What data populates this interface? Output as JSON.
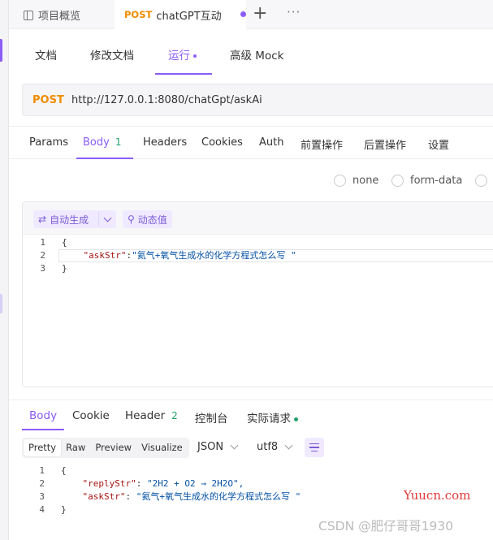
{
  "tabs": {
    "overview_label": "项目概览",
    "active_method": "POST",
    "active_title": "chatGPT互动"
  },
  "subnav": {
    "doc": "文档",
    "edit_doc": "修改文档",
    "run": "运行",
    "mock": "高级 Mock"
  },
  "request": {
    "method": "POST",
    "url": "http://127.0.0.1:8080/chatGpt/askAi"
  },
  "req_tabs": {
    "params": "Params",
    "body": "Body",
    "body_count": "1",
    "headers": "Headers",
    "cookies": "Cookies",
    "auth": "Auth",
    "pre": "前置操作",
    "post": "后置操作",
    "settings": "设置"
  },
  "body_types": {
    "none": "none",
    "form_data": "form-data"
  },
  "editor": {
    "auto_gen": "自动生成",
    "dynamic": "动态值",
    "lines": [
      {
        "n": "1",
        "pre": "{",
        "key": "",
        "mid": "",
        "val": ""
      },
      {
        "n": "2",
        "pre": "    ",
        "key": "\"askStr\"",
        "mid": ":",
        "val": "\"氦气+氧气生成水的化学方程式怎么写 \""
      },
      {
        "n": "3",
        "pre": "}",
        "key": "",
        "mid": "",
        "val": ""
      }
    ]
  },
  "res_tabs": {
    "body": "Body",
    "cookie": "Cookie",
    "header": "Header",
    "header_count": "2",
    "console": "控制台",
    "actual": "实际请求"
  },
  "format": {
    "pretty": "Pretty",
    "raw": "Raw",
    "preview": "Preview",
    "visualize": "Visualize",
    "lang": "JSON",
    "encoding": "utf8"
  },
  "response": {
    "lines": [
      {
        "n": "1",
        "pre": "{",
        "key": "",
        "mid": "",
        "val": ""
      },
      {
        "n": "2",
        "pre": "    ",
        "key": "\"replyStr\"",
        "mid": ": ",
        "val": "\"2H2 + O2 → 2H2O\","
      },
      {
        "n": "3",
        "pre": "    ",
        "key": "\"askStr\"",
        "mid": ": ",
        "val": "\"氦气+氧气生成水的化学方程式怎么写 \""
      },
      {
        "n": "4",
        "pre": "}",
        "key": "",
        "mid": "",
        "val": ""
      }
    ]
  },
  "watermark": {
    "site": "Yuucn.com",
    "csdn": "CSDN @肥仔哥哥1930"
  },
  "colors": {
    "accent": "#8b5cf6",
    "method": "#f08c00",
    "count": "#22a06b"
  }
}
